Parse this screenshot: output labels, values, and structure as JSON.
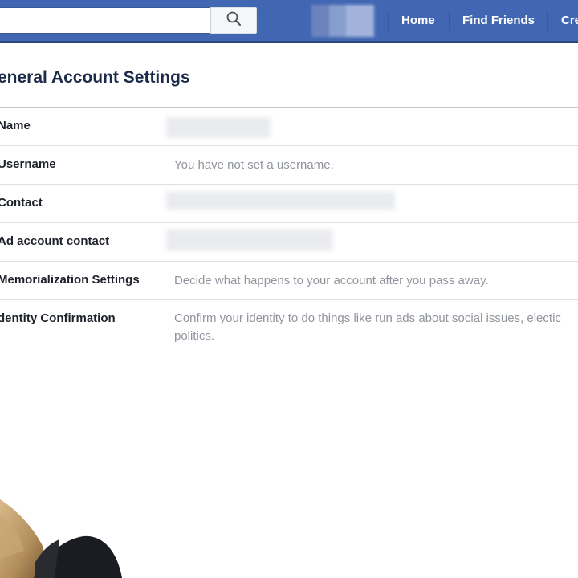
{
  "topbar": {
    "search": {
      "placeholder": "",
      "value": ""
    },
    "nav": [
      {
        "label": "Home"
      },
      {
        "label": "Find Friends"
      },
      {
        "label": "Cre"
      }
    ]
  },
  "settings": {
    "title": "eneral Account Settings",
    "rows": [
      {
        "label": "Name",
        "value": ""
      },
      {
        "label": "Username",
        "value": "You have not set a username."
      },
      {
        "label": "Contact",
        "value": ""
      },
      {
        "label": "Ad account contact",
        "value": ""
      },
      {
        "label": "Memorialization Settings",
        "value": "Decide what happens to your account after you pass away."
      },
      {
        "label": "dentity Confirmation",
        "value": "Confirm your identity to do things like run ads about social issues, electic politics."
      }
    ]
  },
  "colors": {
    "topbar": "#4267b2",
    "title_text": "#1c2b4a",
    "label_text": "#1d2129",
    "value_text": "#90949c",
    "divider": "#dddfe2"
  },
  "icons": {
    "search": "search-icon"
  }
}
